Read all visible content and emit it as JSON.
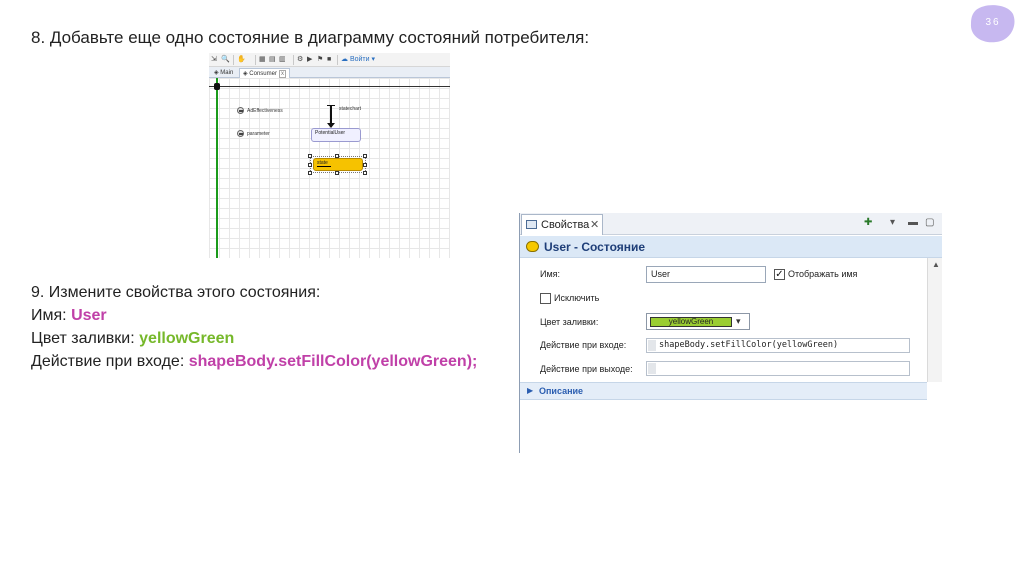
{
  "slide": {
    "number": "36",
    "heading": "8. Добавьте еще одно состояние в диаграмму состояний потребителя:"
  },
  "editor": {
    "toolbar": {
      "find_label": "Войти"
    },
    "tabs": [
      {
        "label": "Main"
      },
      {
        "label": "Consumer"
      }
    ],
    "canvas": {
      "param1_label": "AdEffectiveness",
      "param2_label": "parameter",
      "statechart_label": "statechart",
      "state1_label": "PotentialUser",
      "state2_label": "state"
    }
  },
  "instructions": {
    "line1": "9. Измените свойства этого состояния:",
    "name_prefix": "Имя: ",
    "name_value": "User",
    "fill_prefix": "Цвет заливки: ",
    "fill_value": "yellowGreen",
    "entry_prefix": "Действие при входе: ",
    "entry_value": "shapeBody.setFillColor(yellowGreen);"
  },
  "properties_panel": {
    "tab_label": "Свойства",
    "tab_close": "✕",
    "title": "User - Состояние",
    "name_label": "Имя:",
    "name_value": "User",
    "show_name_label": "Отображать имя",
    "show_name_checked": true,
    "exclude_label": "Исключить",
    "exclude_checked": false,
    "fill_color_label": "Цвет заливки:",
    "fill_color_value": "yellowGreen",
    "fill_color_hex": "#9acd32",
    "entry_action_label": "Действие при входе:",
    "entry_action_value": "shapeBody.setFillColor(yellowGreen)",
    "exit_action_label": "Действие при выходе:",
    "exit_action_value": "",
    "description_label": "Описание"
  },
  "colors": {
    "accent_purple": "#c040a8",
    "accent_green": "#76b82a",
    "badge": "#c7b8f0"
  }
}
